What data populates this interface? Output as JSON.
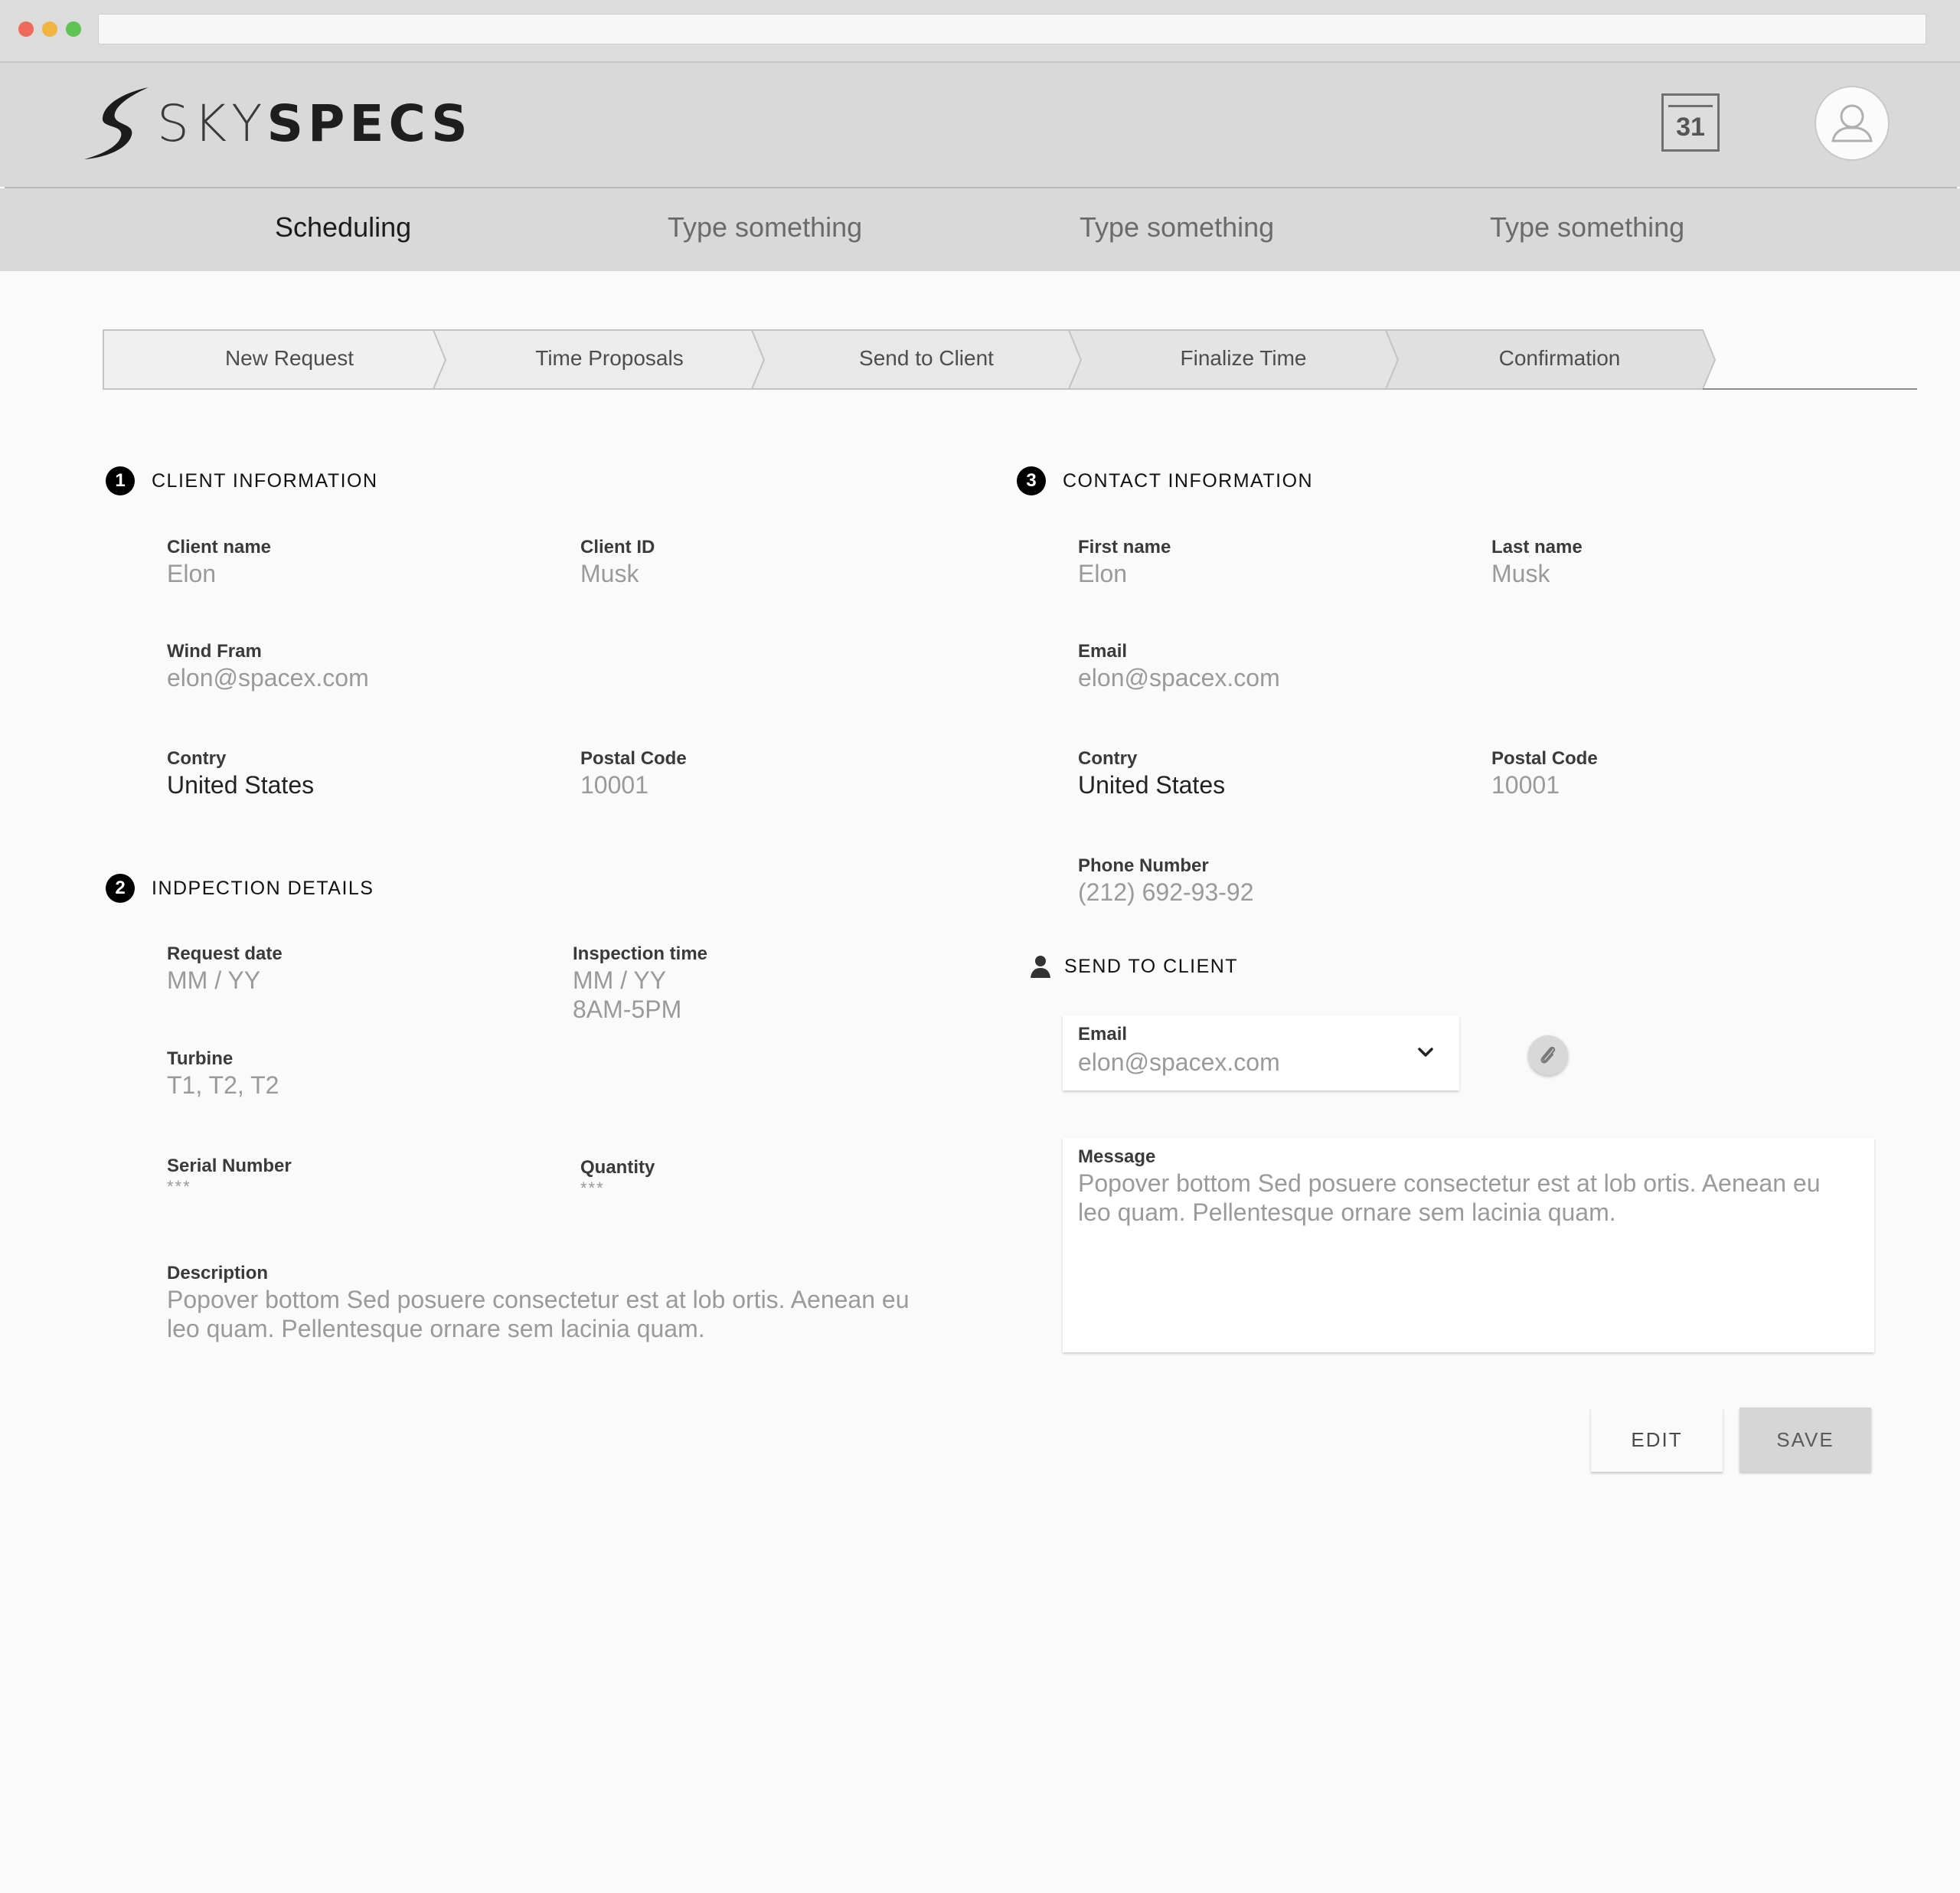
{
  "app": {
    "brand_light": "SKY",
    "brand_bold": "SPECS"
  },
  "header": {
    "calendar_day": "31"
  },
  "nav": {
    "tabs": [
      {
        "label": "Scheduling",
        "active": true
      },
      {
        "label": "Type something"
      },
      {
        "label": "Type something"
      },
      {
        "label": "Type something"
      }
    ]
  },
  "stepper": {
    "steps": [
      "New Request",
      "Time Proposals",
      "Send to Client",
      "Finalize Time",
      "Confirmation"
    ]
  },
  "client_info": {
    "number": "1",
    "title": "CLIENT INFORMATION",
    "client_name": {
      "label": "Client name",
      "value": "Elon"
    },
    "client_id": {
      "label": "Client ID",
      "value": "Musk"
    },
    "wind_farm": {
      "label": "Wind Fram",
      "value": "elon@spacex.com"
    },
    "country": {
      "label": "Contry",
      "value": "United States"
    },
    "postal_code": {
      "label": "Postal Code",
      "value": "10001"
    }
  },
  "inspection": {
    "number": "2",
    "title": "INDPECTION DETAILS",
    "request_date": {
      "label": "Request date",
      "value": "MM / YY"
    },
    "inspection_time": {
      "label": "Inspection time",
      "value": "MM / YY\n8AM-5PM"
    },
    "turbine": {
      "label": "Turbine",
      "value": "T1, T2, T2"
    },
    "serial_number": {
      "label": "Serial Number",
      "value": "***"
    },
    "quantity": {
      "label": "Quantity",
      "value": "***"
    },
    "description": {
      "label": "Description",
      "value": "Popover bottom Sed posuere consectetur est at lob ortis. Aenean eu\nleo quam. Pellentesque ornare sem lacinia quam."
    }
  },
  "contact_info": {
    "number": "3",
    "title": "CONTACT INFORMATION",
    "first_name": {
      "label": "First name",
      "value": "Elon"
    },
    "last_name": {
      "label": "Last name",
      "value": "Musk"
    },
    "email": {
      "label": "Email",
      "value": "elon@spacex.com"
    },
    "country": {
      "label": "Contry",
      "value": "United States"
    },
    "postal_code": {
      "label": "Postal Code",
      "value": "10001"
    },
    "phone": {
      "label": "Phone Number",
      "value": "(212) 692-93-92"
    }
  },
  "send_to_client": {
    "title": "SEND TO CLIENT",
    "icon": "user-icon",
    "email": {
      "label": "Email",
      "value": "elon@spacex.com"
    },
    "message": {
      "label": "Message",
      "value": "Popover bottom Sed posuere consectetur est at lob ortis. Aenean eu\nleo quam. Pellentesque ornare sem lacinia quam."
    }
  },
  "actions": {
    "edit_label": "EDIT",
    "save_label": "SAVE"
  }
}
